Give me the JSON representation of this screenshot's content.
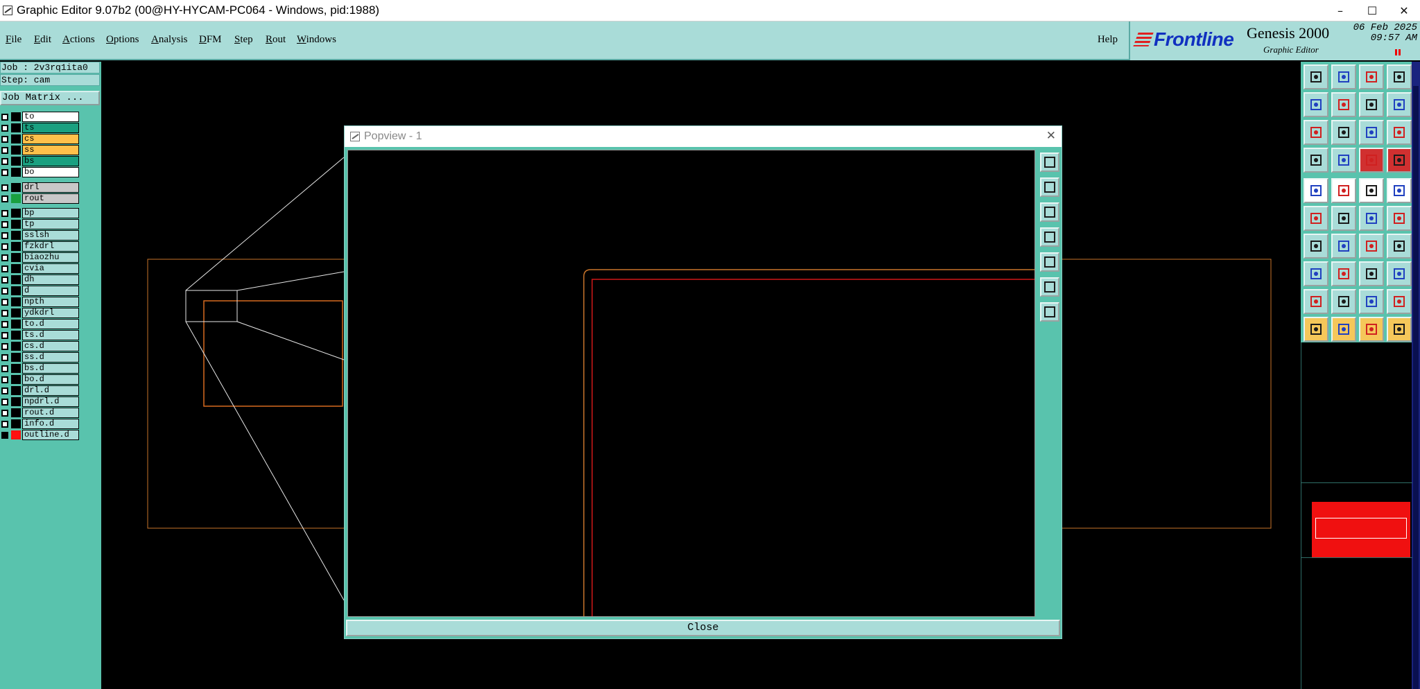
{
  "window": {
    "title": "Graphic Editor 9.07b2 (00@HY-HYCAM-PC064 - Windows, pid:1988)",
    "minimize": "–",
    "maximize": "☐",
    "close": "✕"
  },
  "menu": {
    "items": [
      {
        "first": "F",
        "rest": "ile"
      },
      {
        "first": "E",
        "rest": "dit"
      },
      {
        "first": "A",
        "rest": "ctions"
      },
      {
        "first": "O",
        "rest": "ptions"
      },
      {
        "first": "A",
        "rest": "nalysis"
      },
      {
        "first": "D",
        "rest": "FM"
      },
      {
        "first": "S",
        "rest": "tep"
      },
      {
        "first": "R",
        "rest": "out"
      },
      {
        "first": "W",
        "rest": "indows"
      }
    ],
    "help": "Help"
  },
  "brand": {
    "logo": "Frontline",
    "product": "Genesis 2000",
    "subtitle": "Graphic Editor",
    "date": "06 Feb 2025",
    "time": "09:57 AM"
  },
  "job_info": {
    "job": "Job : 2v3rq1ita0",
    "step": "Step: cam",
    "job_matrix": "Job Matrix ..."
  },
  "layers": [
    {
      "name": "to",
      "bg": "#ffffff",
      "swatch": "#000000"
    },
    {
      "name": "ts",
      "bg": "#1aa080",
      "swatch": "#000000"
    },
    {
      "name": "cs",
      "bg": "#ffc04a",
      "swatch": "#000000"
    },
    {
      "name": "ss",
      "bg": "#ffc04a",
      "swatch": "#000000"
    },
    {
      "name": "bs",
      "bg": "#1aa080",
      "swatch": "#000000"
    },
    {
      "name": "bo",
      "bg": "#ffffff",
      "swatch": "#000000"
    },
    {
      "name": "drl",
      "bg": "#c8c8c8",
      "swatch": "#000000"
    },
    {
      "name": "rout",
      "bg": "#c8c8c8",
      "swatch": "#1aa040"
    },
    {
      "name": "bp",
      "bg": "#a9dcd8",
      "swatch": "#000000"
    },
    {
      "name": "tp",
      "bg": "#a9dcd8",
      "swatch": "#000000"
    },
    {
      "name": "sslsh",
      "bg": "#a9dcd8",
      "swatch": "#000000"
    },
    {
      "name": "fzkdrl",
      "bg": "#a9dcd8",
      "swatch": "#000000"
    },
    {
      "name": "biaozhu",
      "bg": "#a9dcd8",
      "swatch": "#000000"
    },
    {
      "name": "cvia",
      "bg": "#a9dcd8",
      "swatch": "#000000"
    },
    {
      "name": "dh",
      "bg": "#a9dcd8",
      "swatch": "#000000"
    },
    {
      "name": "d",
      "bg": "#a9dcd8",
      "swatch": "#000000"
    },
    {
      "name": "npth",
      "bg": "#a9dcd8",
      "swatch": "#000000"
    },
    {
      "name": "ydkdrl",
      "bg": "#a9dcd8",
      "swatch": "#000000"
    },
    {
      "name": "to.d",
      "bg": "#a9dcd8",
      "swatch": "#000000"
    },
    {
      "name": "ts.d",
      "bg": "#a9dcd8",
      "swatch": "#000000"
    },
    {
      "name": "cs.d",
      "bg": "#a9dcd8",
      "swatch": "#000000"
    },
    {
      "name": "ss.d",
      "bg": "#a9dcd8",
      "swatch": "#000000"
    },
    {
      "name": "bs.d",
      "bg": "#a9dcd8",
      "swatch": "#000000"
    },
    {
      "name": "bo.d",
      "bg": "#a9dcd8",
      "swatch": "#000000"
    },
    {
      "name": "drl.d",
      "bg": "#a9dcd8",
      "swatch": "#000000"
    },
    {
      "name": "npdrl.d",
      "bg": "#a9dcd8",
      "swatch": "#000000"
    },
    {
      "name": "rout.d",
      "bg": "#a9dcd8",
      "swatch": "#000000"
    },
    {
      "name": "info.d",
      "bg": "#a9dcd8",
      "swatch": "#000000"
    },
    {
      "name": "outline.d",
      "bg": "#a9dcd8",
      "swatch": "#ff1010"
    }
  ],
  "popview": {
    "title": "Popview - 1",
    "close_x": "✕",
    "close_button": "Close"
  },
  "colors": {
    "panel_bg": "#59c3ad",
    "menu_bg": "#a9dcd8",
    "outline_orange": "#c8742a",
    "outline_red": "#d01818",
    "active_layer": "#ff1010"
  }
}
